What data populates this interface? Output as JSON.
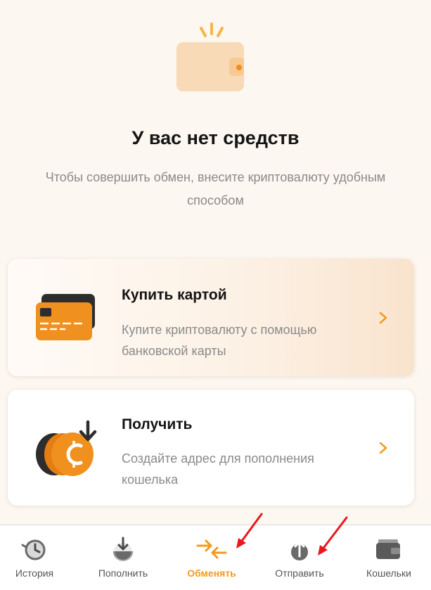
{
  "empty_state": {
    "title": "У вас нет средств",
    "subtitle": "Чтобы совершить обмен, внесите криптовалюту удобным способом"
  },
  "cards": [
    {
      "title": "Купить картой",
      "description": "Купите криптовалюту с помощью банковской карты",
      "icon": "bank-card-icon"
    },
    {
      "title": "Получить",
      "description": "Создайте адрес для пополнения кошелька",
      "icon": "coin-receive-icon"
    }
  ],
  "nav": {
    "items": [
      {
        "label": "История",
        "icon": "history-icon"
      },
      {
        "label": "Пополнить",
        "icon": "deposit-icon"
      },
      {
        "label": "Обменять",
        "icon": "exchange-icon",
        "active": true
      },
      {
        "label": "Отправить",
        "icon": "send-icon"
      },
      {
        "label": "Кошельки",
        "icon": "wallet-icon"
      }
    ]
  },
  "colors": {
    "accent": "#f39a1b",
    "background": "#fdf7f1",
    "annotation_arrow": "#e8191e"
  }
}
